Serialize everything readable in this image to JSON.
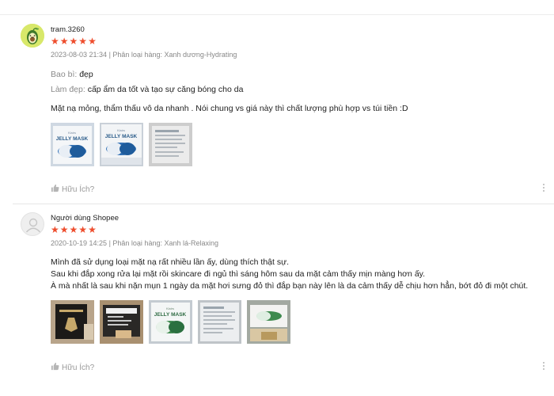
{
  "reviews": [
    {
      "username": "tram.3260",
      "rating": 5,
      "date": "2023-08-03 21:34",
      "separator": " | ",
      "variation": "Phân loại hàng: Xanh dương-Hydrating",
      "attributes": [
        {
          "key": "Bao bì: ",
          "value": "đẹp"
        },
        {
          "key": "Làm đẹp: ",
          "value": "cấp ẩm da tốt và tạo sự căng bóng cho da"
        }
      ],
      "body_lines": [
        "Mặt nạ mỏng, thẩm thấu vô da nhanh . Nói chung vs giá này thì chất lượng phù hợp vs túi tiền :D"
      ],
      "images": [
        "blue-jelly-mask-package",
        "blue-jelly-mask-package",
        "jelly-mask-package-back"
      ],
      "helpful_label": "Hữu Ích?"
    },
    {
      "username": "Người dùng Shopee",
      "rating": 5,
      "date": "2020-10-19 14:25",
      "separator": " | ",
      "variation": "Phân loại hàng: Xanh lá-Relaxing",
      "attributes": [],
      "body_lines": [
        "Mình đã sử dụng loại mặt nạ rất nhiều lần ấy, dùng thích thật sự.",
        "Sau khi đắp xong rửa lại mặt rồi skincare đi ngủ thì sáng hôm sau da mặt cảm thấy mịn màng hơn ấy.",
        "À mà nhất là sau khi nặn mụn 1 ngày da mặt hơi sưng đỏ thì đắp bạn này lên là da cảm thấy dễ chịu hơn hẳn, bớt đỏ đi một chút."
      ],
      "images": [
        "black-product-box",
        "product-box-label",
        "green-jelly-mask-package",
        "jelly-mask-package-back",
        "green-capsule-box"
      ],
      "helpful_label": "Hữu Ích?"
    }
  ],
  "colors": {
    "star": "#ee4d2d",
    "muted_text": "#888888",
    "helpful_text": "#9a9a9a"
  },
  "icons": {
    "star": "star-icon",
    "thumbs_up": "thumbs-up-icon",
    "more": "more-options-icon",
    "avatar_default": "default-user-icon",
    "avatar_custom": "avocado-avatar"
  }
}
